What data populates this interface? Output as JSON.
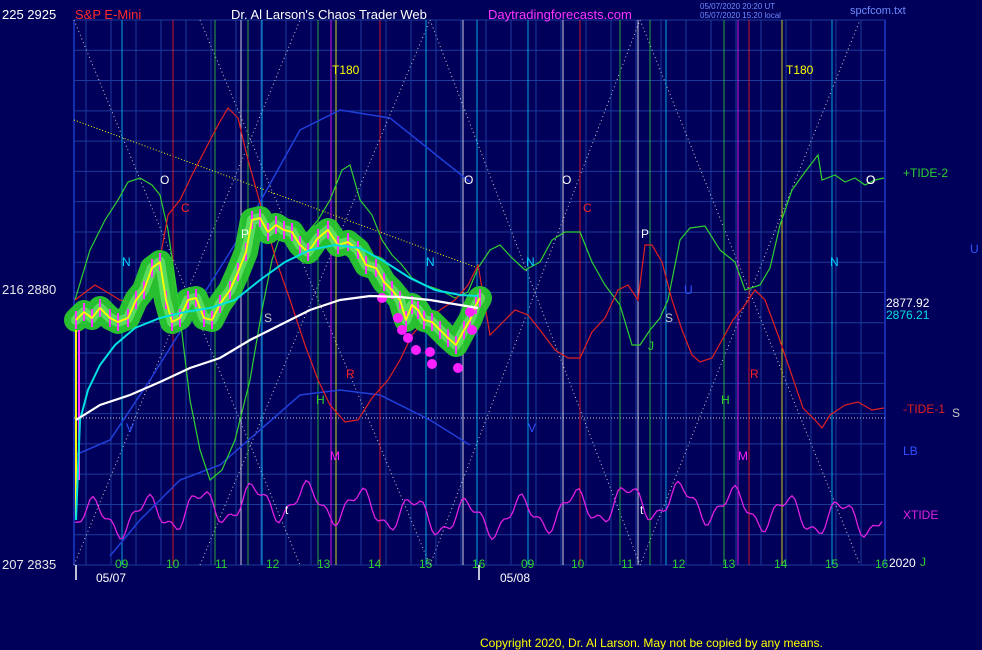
{
  "header": {
    "left_price": "225  2925",
    "symbol": "S&P E-Mini",
    "title": "Dr. Al Larson's Chaos Trader Web",
    "site": "Daytradingforecasts.com",
    "stamp_line1": "05/07/2020 20:20 UT",
    "stamp_line2": "05/07/2020 15:20 local",
    "filename": "spcfcom.txt"
  },
  "y_axis": {
    "top": "225  2925",
    "mid": "216  2880",
    "bottom": "207  2835"
  },
  "x_axis": {
    "hours": [
      "09",
      "10",
      "11",
      "12",
      "13",
      "14",
      "15",
      "16",
      "09",
      "10",
      "11",
      "12",
      "13",
      "14",
      "15",
      "16"
    ],
    "dates": [
      "05/07",
      "05/08"
    ],
    "year": "2020"
  },
  "right_labels": {
    "tide2": "+TIDE-2",
    "tide1": "-TIDE-1",
    "lb": "LB",
    "xtide": "XTIDE",
    "u": "U",
    "s": "S",
    "price1": "2877.92",
    "price2": "2876.21"
  },
  "markers": {
    "t180": [
      "T180",
      "T180"
    ],
    "letters": [
      "O",
      "O",
      "O",
      "O",
      "O",
      "C",
      "C",
      "P",
      "P",
      "N",
      "N",
      "N",
      "N",
      "S",
      "S",
      "R",
      "R",
      "H",
      "H",
      "M",
      "M",
      "V",
      "V",
      "U",
      "J",
      "t",
      "t",
      "J"
    ]
  },
  "footer": {
    "copyright": "Copyright 2020, Dr. Al Larson. May not be copied by any means."
  },
  "colors": {
    "background": "#00005a",
    "grid": "#1c3a9a",
    "price": "#ffff00",
    "glow": "#33e033",
    "ema_cyan": "#00e0e0",
    "ma_white": "#ffffff",
    "tide_red": "#e02020",
    "tide_green": "#30d030",
    "xtide": "#e020e0",
    "lb_blue": "#1f3fd8",
    "symbol_red": "#ff2020",
    "title_white": "#ffffff",
    "site_magenta": "#ff33ff"
  },
  "chart_data": {
    "type": "line",
    "title": "S&P E-Mini",
    "ylim": [
      2835,
      2925
    ],
    "y_ticks": [
      2925,
      2880,
      2835
    ],
    "x": [
      "09",
      "10",
      "11",
      "12",
      "13",
      "14",
      "15",
      "16",
      "09",
      "10",
      "11",
      "12",
      "13",
      "14",
      "15",
      "16"
    ],
    "series": [
      {
        "name": "S&P E-Mini",
        "values": [
          2882,
          2871,
          2882,
          2874,
          2891,
          2890,
          2883,
          2877,
          2873
        ]
      },
      {
        "name": "+TIDE-2",
        "values": [
          2899,
          2888,
          2862,
          2907,
          2889,
          2881,
          2872,
          2889,
          2895,
          2896,
          2878,
          2877,
          2901,
          2905,
          2908,
          2903
        ]
      },
      {
        "name": "-TIDE-1",
        "values": [
          2878,
          2899,
          2906,
          2889,
          2865,
          2866,
          2876,
          2888,
          2871,
          2883,
          2884,
          2873,
          2882,
          2872,
          2858,
          2861
        ]
      },
      {
        "name": "XTIDE",
        "values": [
          2846,
          2851,
          2849,
          2847,
          2844,
          2849,
          2851,
          2846,
          2849,
          2845,
          2851,
          2846,
          2843,
          2849,
          2852,
          2850
        ]
      },
      {
        "name": "LB",
        "values": [
          2858,
          2872,
          2888,
          2912,
          2908,
          2896,
          2880,
          2866,
          2861
        ]
      }
    ],
    "price_labels": [
      "2877.92",
      "2876.21"
    ]
  }
}
